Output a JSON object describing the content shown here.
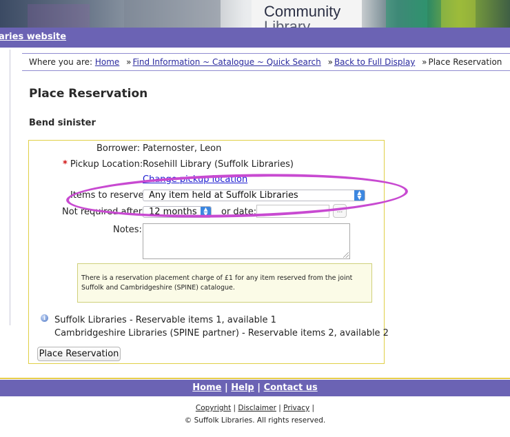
{
  "banner": {
    "sign_line1": "Community",
    "sign_line2": "Library"
  },
  "topbar": {
    "link": "aries website"
  },
  "breadcrumb": {
    "prefix": "Where you are:",
    "items": [
      {
        "label": "Home"
      },
      {
        "label": "Find Information ~ Catalogue ~ Quick Search"
      },
      {
        "label": "Back to Full Display"
      },
      {
        "label": "Place Reservation"
      }
    ],
    "separator": "»"
  },
  "page": {
    "title": "Place Reservation",
    "item_title": "Bend sinister"
  },
  "form": {
    "borrower_label": "Borrower:",
    "borrower_value": "Paternoster, Leon",
    "pickup_required_mark": "*",
    "pickup_label": "Pickup Location:",
    "pickup_value": "Rosehill Library (Suffolk Libraries)",
    "change_pickup_link": "Change pickup location",
    "items_label": "Items to reserve:",
    "items_selected": "Any item held at Suffolk Libraries",
    "not_required_label": "Not required after:",
    "not_required_selected": "12 months",
    "or_date_label": "or date:",
    "date_value": "",
    "date_button": "...",
    "notes_label": "Notes:",
    "notes_value": "",
    "notice": "There is a reservation placement charge of £1 for any item reserved from the joint Suffolk and Cambridgeshire (SPINE) catalogue.",
    "availability": [
      "Suffolk Libraries - Reservable items 1, available 1",
      "Cambridgeshire Libraries (SPINE partner) - Reservable items 2, available 2"
    ],
    "submit_label": "Place Reservation"
  },
  "annotation": {
    "color": "#c84ad1"
  },
  "footer": {
    "links": [
      {
        "label": "Home"
      },
      {
        "label": "Help"
      },
      {
        "label": "Contact us"
      }
    ],
    "legal_links": [
      {
        "label": "Copyright"
      },
      {
        "label": "Disclaimer"
      },
      {
        "label": "Privacy"
      }
    ],
    "copyright": "© Suffolk Libraries. All rights reserved."
  },
  "colors": {
    "nav_bar": "#6b63b4",
    "form_border": "#e0cf45",
    "link": "#2a2a9e",
    "select_arrow": "#3c87e0"
  }
}
